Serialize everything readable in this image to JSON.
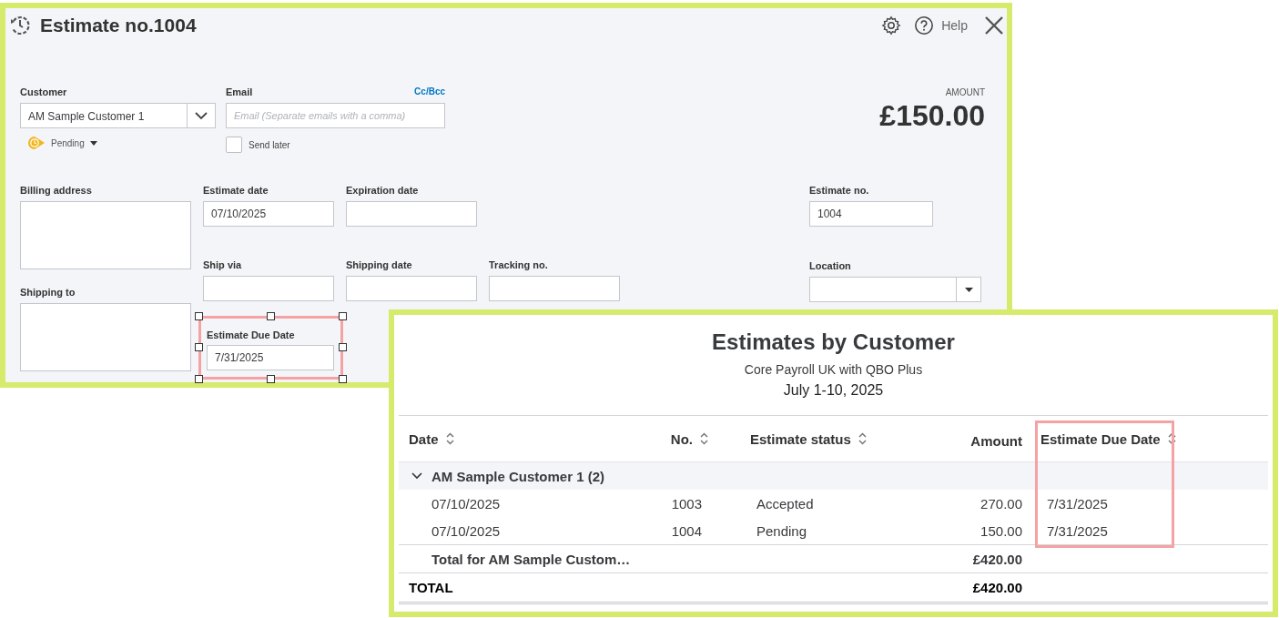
{
  "estimate_form": {
    "title": "Estimate no.1004",
    "help": "Help",
    "customer": {
      "label": "Customer",
      "value": "AM Sample Customer 1"
    },
    "status": "Pending",
    "email": {
      "label": "Email",
      "cc_bcc": "Cc/Bcc",
      "placeholder": "Email (Separate emails with a comma)"
    },
    "send_later": {
      "label": "Send later",
      "checked": false
    },
    "amount": {
      "label": "AMOUNT",
      "value": "£150.00"
    },
    "billing_address": {
      "label": "Billing address"
    },
    "shipping_to": {
      "label": "Shipping to"
    },
    "fields": [
      {
        "label": "Estimate date",
        "value": "07/10/2025"
      },
      {
        "label": "Expiration date"
      },
      {
        "label": "Ship via"
      },
      {
        "label": "Shipping date"
      },
      {
        "label": "Tracking no."
      }
    ],
    "estimate_no": {
      "label": "Estimate no.",
      "value": "1004"
    },
    "location": {
      "label": "Location"
    },
    "estimate_due_date": {
      "label": "Estimate Due Date",
      "value": "7/31/2025",
      "selected": true
    }
  },
  "report": {
    "title": "Estimates by Customer",
    "company": "Core Payroll UK with QBO Plus",
    "date_range": "July 1-10, 2025",
    "columns": [
      {
        "label": "Date",
        "sortable": true,
        "highlighted": false
      },
      {
        "label": "No.",
        "sortable": true,
        "highlighted": false
      },
      {
        "label": "Estimate status",
        "sortable": true,
        "highlighted": false
      },
      {
        "label": "Amount",
        "sortable": false,
        "highlighted": false
      },
      {
        "label": "Estimate Due Date",
        "sortable": true,
        "highlighted": true
      }
    ],
    "group": {
      "label": "AM Sample Customer 1 (2)",
      "expanded": true,
      "rows": [
        [
          "07/10/2025",
          "1003",
          "Accepted",
          "270.00",
          "7/31/2025"
        ],
        [
          "07/10/2025",
          "1004",
          "Pending",
          "150.00",
          "7/31/2025"
        ]
      ],
      "total": {
        "label": "Total for AM Sample Custom…",
        "amount": "£420.00"
      }
    },
    "total": {
      "label": "TOTAL",
      "amount": "£420.00"
    }
  }
}
